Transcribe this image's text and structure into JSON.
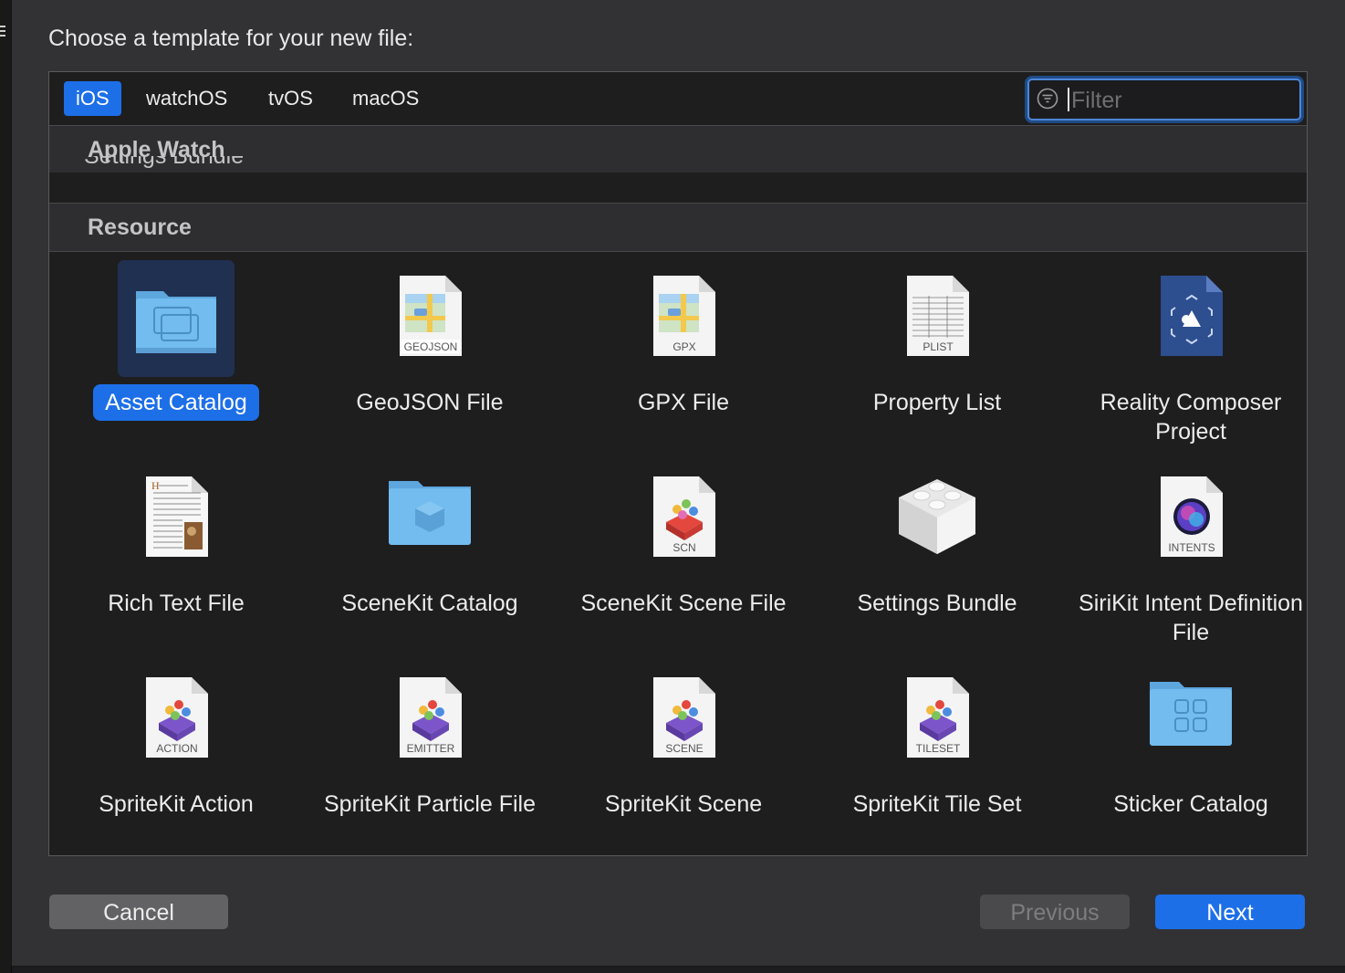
{
  "dialog": {
    "title": "Choose a template for your new file:"
  },
  "tabs": [
    {
      "label": "iOS",
      "active": true
    },
    {
      "label": "watchOS",
      "active": false
    },
    {
      "label": "tvOS",
      "active": false
    },
    {
      "label": "macOS",
      "active": false
    }
  ],
  "filter": {
    "placeholder": "Filter",
    "value": ""
  },
  "sections": {
    "apple_watch": "Apple Watch",
    "apple_watch_item": "Settings Bundle",
    "resource": "Resource"
  },
  "templates": [
    {
      "label": "Asset Catalog",
      "icon": "folder-asset-catalog-icon",
      "selected": true
    },
    {
      "label": "GeoJSON File",
      "icon": "document-map-icon",
      "badge": "GEOJSON"
    },
    {
      "label": "GPX File",
      "icon": "document-map-icon",
      "badge": "GPX"
    },
    {
      "label": "Property List",
      "icon": "document-table-icon",
      "badge": "PLIST"
    },
    {
      "label": "Reality Composer Project",
      "icon": "reality-composer-icon"
    },
    {
      "label": "Rich Text File",
      "icon": "document-richtext-icon"
    },
    {
      "label": "SceneKit Catalog",
      "icon": "folder-scenekit-icon"
    },
    {
      "label": "SceneKit Scene File",
      "icon": "document-scenekit-icon",
      "badge": "SCN"
    },
    {
      "label": "Settings Bundle",
      "icon": "lego-brick-icon"
    },
    {
      "label": "SiriKit Intent Definition File",
      "icon": "document-siri-icon",
      "badge": "INTENTS"
    },
    {
      "label": "SpriteKit Action",
      "icon": "document-spritekit-icon",
      "badge": "ACTION"
    },
    {
      "label": "SpriteKit Particle File",
      "icon": "document-spritekit-icon",
      "badge": "EMITTER"
    },
    {
      "label": "SpriteKit Scene",
      "icon": "document-spritekit-icon",
      "badge": "SCENE"
    },
    {
      "label": "SpriteKit Tile Set",
      "icon": "document-spritekit-icon",
      "badge": "TILESET"
    },
    {
      "label": "Sticker Catalog",
      "icon": "folder-sticker-icon"
    }
  ],
  "buttons": {
    "cancel": "Cancel",
    "previous": "Previous",
    "next": "Next"
  },
  "colors": {
    "accent": "#1d6fe8",
    "folder": "#6fb8ee",
    "background": "#1e1e1f"
  }
}
